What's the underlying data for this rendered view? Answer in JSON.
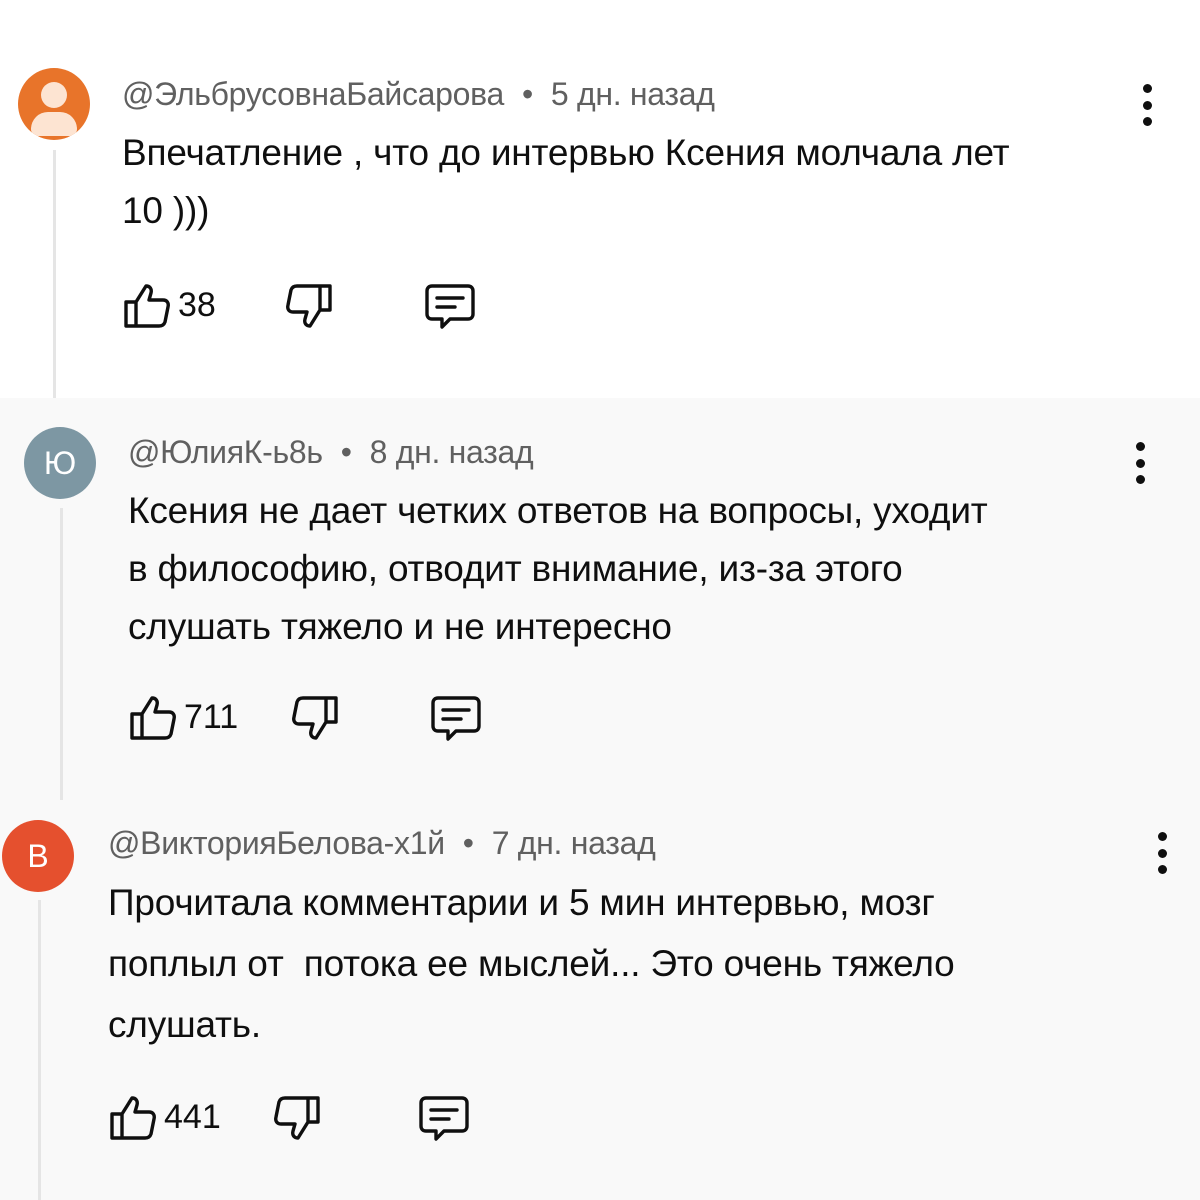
{
  "comments": [
    {
      "author": "@ЭльбрусовнаБайсарова",
      "time": "5 дн. назад",
      "separator": "•",
      "avatar_letter": "",
      "avatar_color": "#e8742a",
      "text_lines": [
        "Впечатление , что до интервью Ксения молчала лет",
        "10 )))"
      ],
      "likes": "38"
    },
    {
      "author": "@ЮлияК-ь8ь",
      "time": "8 дн. назад",
      "separator": "•",
      "avatar_letter": "Ю",
      "avatar_color": "#7d97a3",
      "text_lines": [
        "Ксения не дает четких ответов на вопросы, уходит",
        "в философию, отводит внимание, из-за этого",
        "слушать тяжело и не интересно"
      ],
      "likes": "711"
    },
    {
      "author": "@ВикторияБелова-х1й",
      "time": "7 дн. назад",
      "separator": "•",
      "avatar_letter": "В",
      "avatar_color": "#e5502e",
      "text_lines": [
        "Прочитала комментарии и 5 мин интервью, мозг",
        "поплыл от  потока ее мыслей... Это очень тяжело",
        "слушать."
      ],
      "likes": "441"
    }
  ],
  "icons": {
    "like": "thumbs-up-icon",
    "dislike": "thumbs-down-icon",
    "reply": "reply-icon",
    "more": "more-vertical-icon"
  }
}
